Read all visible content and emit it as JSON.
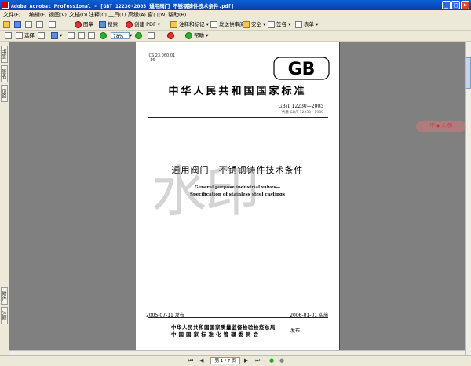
{
  "window": {
    "title": "Adobe Acrobat Professional - [GBT 12230-2005 通用阀门 不锈钢铸件技术条件.pdf]"
  },
  "menu": [
    {
      "label": "文件",
      "key": "(F)"
    },
    {
      "label": "编辑",
      "key": "(E)"
    },
    {
      "label": "视图",
      "key": "(V)"
    },
    {
      "label": "文档",
      "key": "(D)"
    },
    {
      "label": "注释",
      "key": "(C)"
    },
    {
      "label": "工具",
      "key": "(T)"
    },
    {
      "label": "高级",
      "key": "(A)"
    },
    {
      "label": "窗口",
      "key": "(W)"
    },
    {
      "label": "帮助",
      "key": "(H)"
    }
  ],
  "toolbar1": {
    "organize": "图章",
    "search": "搜索",
    "create_pdf": "创建 PDF",
    "review": "注释和标记",
    "send_review": "发送供审阅",
    "secure": "安全",
    "sign": "签名",
    "forms": "表单"
  },
  "toolbar2": {
    "select": "选择",
    "zoom_value": "78%",
    "help": "帮助"
  },
  "sidebar": {
    "tabs": [
      "书签",
      "签名",
      "页面",
      "附件",
      "注释"
    ]
  },
  "page": {
    "ics": "ICS 23.060.01",
    "ccs": "J 16",
    "logo": "GB",
    "std_title": "中华人民共和国国家标准",
    "std_number": "GB/T 12230—2005",
    "replaces": "代替 GB/T 12230—1989",
    "doc_title": "通用阀门　不锈钢铸件技术条件",
    "en_title_1": "General purpose industrial valves—",
    "en_title_2": "Specification of stainless steel castings",
    "watermark": "水印",
    "pub_date": "2005-07-11 发布",
    "impl_date": "2006-01-01 实施",
    "issuer_1": "中华人民共和国国家质量监督检验检疫总局",
    "issuer_2": "中国国家标准化管理委员会",
    "issue_word": "发布"
  },
  "stamp_text": "中 ◆ 入 强",
  "status": {
    "page_indicator": "第 1 / 7 页"
  }
}
